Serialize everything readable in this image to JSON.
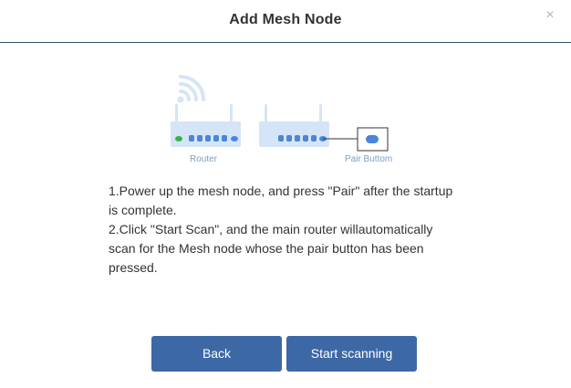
{
  "dialog": {
    "title": "Add Mesh Node",
    "close_icon": "close-icon",
    "close_glyph": "×"
  },
  "illustration": {
    "router_label": "Router",
    "pair_button_label": "Pair Buttom",
    "colors": {
      "device_fill": "#d5e5f7",
      "device_dots": "#4a86d9",
      "power_led": "#33b54a",
      "wifi_waves": "#d5e5f7"
    }
  },
  "instructions": {
    "step1": "1.Power up the mesh node, and press \"Pair\" after the startup is complete.",
    "step2": "2.Click \"Start Scan\", and the main router willautomatically scan for the Mesh node whose the pair button has been pressed."
  },
  "buttons": {
    "back_label": "Back",
    "scan_label": "Start scanning",
    "color": "#3d68a6"
  }
}
